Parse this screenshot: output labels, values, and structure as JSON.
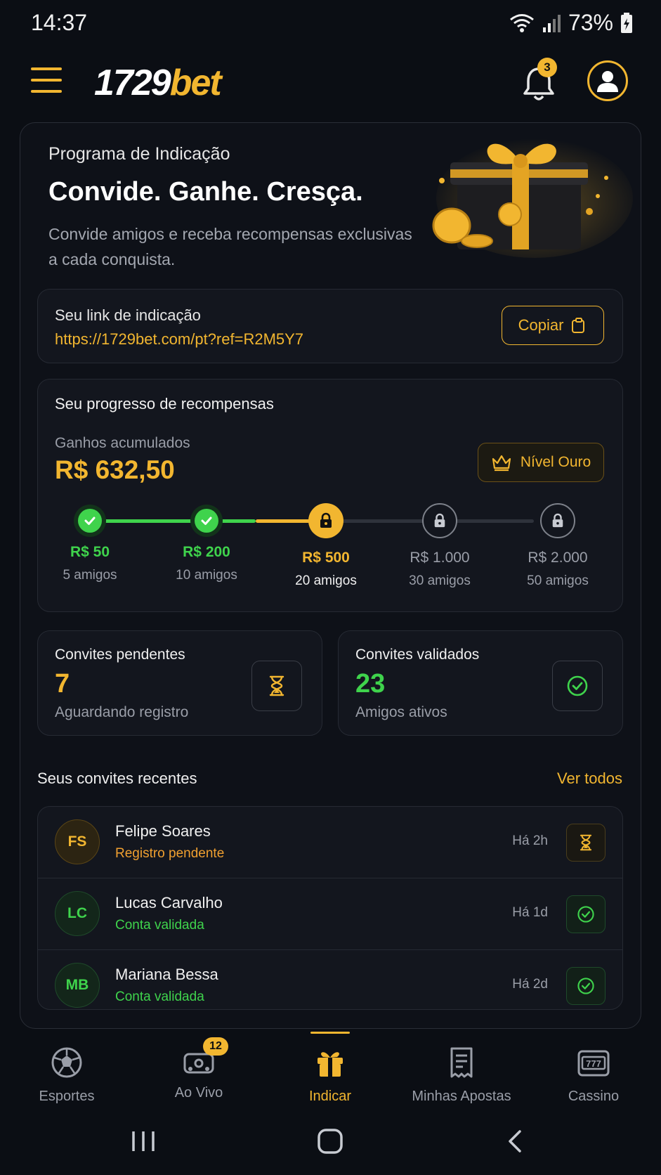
{
  "status_bar": {
    "time": "14:37",
    "battery": "73%"
  },
  "header": {
    "logo_part1": "1729",
    "logo_part2": "bet",
    "notification_count": "3"
  },
  "hero": {
    "kicker": "Programa de Indicação",
    "title": "Convide. Ganhe. Cresça.",
    "description": "Convide amigos e receba recompensas exclusivas a cada conquista."
  },
  "referral_link": {
    "label": "Seu link de indicação",
    "url": "https://1729bet.com/pt?ref=R2M5Y7",
    "copy_label": "Copiar"
  },
  "progress": {
    "title": "Seu progresso de recompensas",
    "accumulated_label": "Ganhos acumulados",
    "accumulated_value": "R$ 632,50",
    "level": "Nível Ouro",
    "steps": [
      {
        "reward": "R$ 50",
        "friends": "5 amigos",
        "state": "done"
      },
      {
        "reward": "R$ 200",
        "friends": "10 amigos",
        "state": "done"
      },
      {
        "reward": "R$ 500",
        "friends": "20 amigos",
        "state": "current"
      },
      {
        "reward": "R$ 1.000",
        "friends": "30 amigos",
        "state": "locked"
      },
      {
        "reward": "R$ 2.000",
        "friends": "50 amigos",
        "state": "locked"
      }
    ]
  },
  "stats": {
    "pending": {
      "title": "Convites pendentes",
      "value": "7",
      "subtitle": "Aguardando registro",
      "icon": "hourglass-icon"
    },
    "validated": {
      "title": "Convites validados",
      "value": "23",
      "subtitle": "Amigos ativos",
      "icon": "check-circle-icon"
    }
  },
  "recent": {
    "title": "Seus convites recentes",
    "see_all": "Ver todos",
    "items": [
      {
        "initials": "FS",
        "name": "Felipe Soares",
        "status": "Registro pendente",
        "time": "Há 2h",
        "state": "pending"
      },
      {
        "initials": "LC",
        "name": "Lucas Carvalho",
        "status": "Conta validada",
        "time": "Há 1d",
        "state": "validated"
      },
      {
        "initials": "MB",
        "name": "Mariana Bessa",
        "status": "Conta validada",
        "time": "Há 2d",
        "state": "validated"
      }
    ]
  },
  "bottom_nav": {
    "items": [
      {
        "label": "Esportes",
        "icon": "soccer-ball-icon"
      },
      {
        "label": "Ao Vivo",
        "icon": "live-icon",
        "badge": "12"
      },
      {
        "label": "Indicar",
        "icon": "gift-icon",
        "active": true
      },
      {
        "label": "Minhas Apostas",
        "icon": "receipt-icon"
      },
      {
        "label": "Cassino",
        "icon": "slot-machine-icon"
      }
    ]
  },
  "colors": {
    "accent": "#f2b630",
    "success": "#3fd34c",
    "background": "#0b0e14"
  }
}
